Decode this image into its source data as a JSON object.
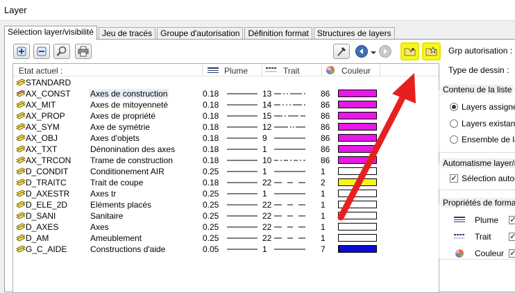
{
  "window": {
    "title": "Layer"
  },
  "tabs": [
    "Sélection layer/visibilité",
    "Jeu de tracés",
    "Groupe d'autorisation",
    "Définition format",
    "Structures de layers"
  ],
  "list": {
    "headers": {
      "state": "Etat actuel :",
      "pen": "Plume",
      "line": "Trait",
      "color": "Couleur"
    },
    "rows": [
      {
        "name": "STANDARD",
        "desc": "",
        "pen": "",
        "line": "",
        "color_num": "",
        "color": ""
      },
      {
        "name": "AX_CONST",
        "desc": "Axes de construction",
        "pen": "0.18",
        "line": "13",
        "color_num": "86",
        "color": "#e619e6"
      },
      {
        "name": "AX_MIT",
        "desc": "Axes de mitoyenneté",
        "pen": "0.18",
        "line": "14",
        "color_num": "86",
        "color": "#e619e6"
      },
      {
        "name": "AX_PROP",
        "desc": "Axes de propriété",
        "pen": "0.18",
        "line": "15",
        "color_num": "86",
        "color": "#e619e6"
      },
      {
        "name": "AX_SYM",
        "desc": "Axe de symétrie",
        "pen": "0.18",
        "line": "12",
        "color_num": "86",
        "color": "#e619e6"
      },
      {
        "name": "AX_OBJ",
        "desc": "Axes d'objets",
        "pen": "0.18",
        "line": "9",
        "color_num": "86",
        "color": "#e619e6"
      },
      {
        "name": "AX_TXT",
        "desc": "Dénonination des axes",
        "pen": "0.18",
        "line": "1",
        "color_num": "86",
        "color": "#e619e6"
      },
      {
        "name": "AX_TRCON",
        "desc": "Trame de construction",
        "pen": "0.18",
        "line": "10",
        "color_num": "86",
        "color": "#e619e6"
      },
      {
        "name": "D_CONDIT",
        "desc": "Conditionement AIR",
        "pen": "0.25",
        "line": "1",
        "color_num": "1",
        "color": "#ffffff"
      },
      {
        "name": "D_TRAITC",
        "desc": "Trait de coupe",
        "pen": "0.18",
        "line": "22",
        "color_num": "2",
        "color": "#f5f51a"
      },
      {
        "name": "D_AXESTR",
        "desc": "Axes tr",
        "pen": "0.25",
        "line": "1",
        "color_num": "1",
        "color": "#ffffff"
      },
      {
        "name": "D_ELE_2D",
        "desc": "Eléments placés",
        "pen": "0.25",
        "line": "22",
        "color_num": "1",
        "color": "#ffffff"
      },
      {
        "name": "D_SANI",
        "desc": "Sanitaire",
        "pen": "0.25",
        "line": "22",
        "color_num": "1",
        "color": "#ffffff"
      },
      {
        "name": "D_AXES",
        "desc": "Axes",
        "pen": "0.25",
        "line": "22",
        "color_num": "1",
        "color": "#ffffff"
      },
      {
        "name": "D_AM",
        "desc": "Ameublement",
        "pen": "0.25",
        "line": "22",
        "color_num": "1",
        "color": "#ffffff"
      },
      {
        "name": "G_C_AIDE",
        "desc": "Constructions d'aide",
        "pen": "0.05",
        "line": "1",
        "color_num": "7",
        "color": "#0a0ad2"
      }
    ]
  },
  "right": {
    "grp_auth": "Grp autorisation :",
    "type_dessin": "Type de dessin :",
    "contenu_title": "Contenu de la liste",
    "opt_assigned": "Layers assignés à",
    "opt_existing": "Layers existants d",
    "opt_all": "Ensemble de la hi",
    "auto_title": "Automatisme layer/m",
    "auto_sel": "Sélection automat",
    "props_title": "Propriétés de format",
    "prop_pen": "Plume",
    "prop_line": "Trait",
    "prop_color": "Couleur"
  },
  "colors": {
    "highlight": "#f7f71e",
    "arrow": "#e62020",
    "magenta": "#e619e6"
  }
}
